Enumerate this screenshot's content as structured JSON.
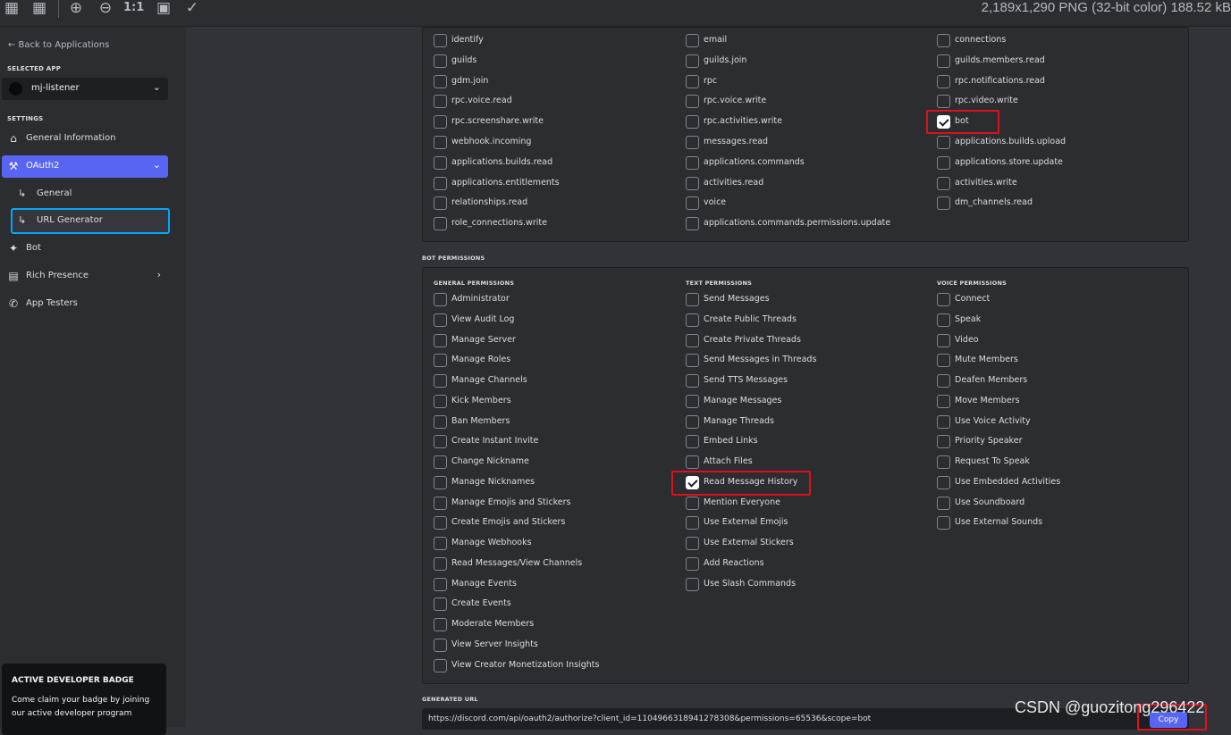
{
  "viewer": {
    "info": "2,189x1,290 PNG (32-bit color) 188.52 kB",
    "icons": [
      "checker-icon",
      "grid-icon",
      "zoom-in-icon",
      "zoom-out-icon",
      "actual-size-icon",
      "fit-icon",
      "eyedropper-icon"
    ],
    "actual_size_label": "1:1"
  },
  "sidebar": {
    "back_label": "← Back to Applications",
    "selected_app_heading": "SELECTED APP",
    "app_name": "mj-listener",
    "settings_heading": "SETTINGS",
    "items": [
      {
        "label": "General Information",
        "icon": "home-icon"
      },
      {
        "label": "OAuth2",
        "icon": "wrench-icon"
      },
      {
        "label": "General",
        "icon": "sub-arrow-icon"
      },
      {
        "label": "URL Generator",
        "icon": "sub-arrow-icon"
      },
      {
        "label": "Bot",
        "icon": "puzzle-icon"
      },
      {
        "label": "Rich Presence",
        "icon": "document-icon"
      },
      {
        "label": "App Testers",
        "icon": "user-plus-icon"
      }
    ],
    "badge": {
      "title": "ACTIVE DEVELOPER BADGE",
      "text": "Come claim your badge by joining our active developer program"
    }
  },
  "scopes": {
    "col1": [
      "identify",
      "guilds",
      "gdm.join",
      "rpc.voice.read",
      "rpc.screenshare.write",
      "webhook.incoming",
      "applications.builds.read",
      "applications.entitlements",
      "relationships.read",
      "role_connections.write"
    ],
    "col2": [
      "email",
      "guilds.join",
      "rpc",
      "rpc.voice.write",
      "rpc.activities.write",
      "messages.read",
      "applications.commands",
      "activities.read",
      "voice",
      "applications.commands.permissions.update"
    ],
    "col3": [
      "connections",
      "guilds.members.read",
      "rpc.notifications.read",
      "rpc.video.write",
      "bot",
      "applications.builds.upload",
      "applications.store.update",
      "activities.write",
      "dm_channels.read"
    ],
    "checked": [
      "bot"
    ]
  },
  "bot_permissions": {
    "heading": "BOT PERMISSIONS",
    "general_heading": "GENERAL PERMISSIONS",
    "text_heading": "TEXT PERMISSIONS",
    "voice_heading": "VOICE PERMISSIONS",
    "general": [
      "Administrator",
      "View Audit Log",
      "Manage Server",
      "Manage Roles",
      "Manage Channels",
      "Kick Members",
      "Ban Members",
      "Create Instant Invite",
      "Change Nickname",
      "Manage Nicknames",
      "Manage Emojis and Stickers",
      "Create Emojis and Stickers",
      "Manage Webhooks",
      "Read Messages/View Channels",
      "Manage Events",
      "Create Events",
      "Moderate Members",
      "View Server Insights",
      "View Creator Monetization Insights"
    ],
    "text": [
      "Send Messages",
      "Create Public Threads",
      "Create Private Threads",
      "Send Messages in Threads",
      "Send TTS Messages",
      "Manage Messages",
      "Manage Threads",
      "Embed Links",
      "Attach Files",
      "Read Message History",
      "Mention Everyone",
      "Use External Emojis",
      "Use External Stickers",
      "Add Reactions",
      "Use Slash Commands"
    ],
    "voice": [
      "Connect",
      "Speak",
      "Video",
      "Mute Members",
      "Deafen Members",
      "Move Members",
      "Use Voice Activity",
      "Priority Speaker",
      "Request To Speak",
      "Use Embedded Activities",
      "Use Soundboard",
      "Use External Sounds"
    ],
    "checked": [
      "Read Message History"
    ]
  },
  "generated_url": {
    "heading": "GENERATED URL",
    "value": "https://discord.com/api/oauth2/authorize?client_id=1104966318941278308&permissions=65536&scope=bot",
    "copy_label": "Copy"
  },
  "watermark": "CSDN @guozitong296422",
  "colors": {
    "accent": "#5865f2",
    "highlight": "#e0101a",
    "focus": "#00a8fc"
  }
}
